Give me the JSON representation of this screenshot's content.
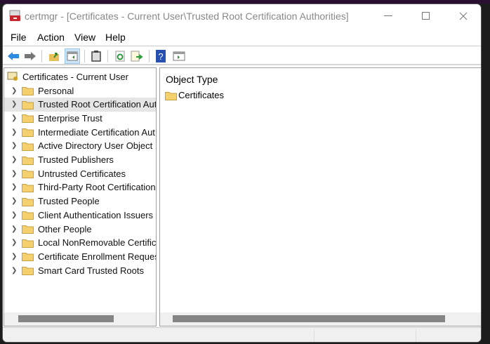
{
  "window": {
    "title": "certmgr - [Certificates - Current User\\Trusted Root Certification Authorities]"
  },
  "menu": [
    "File",
    "Action",
    "View",
    "Help"
  ],
  "toolbar": [
    "back-icon",
    "forward-icon",
    "up-folder-icon",
    "show-hide-tree-icon",
    "clipboard-icon",
    "refresh-icon",
    "export-list-icon",
    "help-icon",
    "show-action-pane-icon"
  ],
  "tree": {
    "root": "Certificates - Current User",
    "items": [
      "Personal",
      "Trusted Root Certification Aut",
      "Enterprise Trust",
      "Intermediate Certification Aut",
      "Active Directory User Object",
      "Trusted Publishers",
      "Untrusted Certificates",
      "Third-Party Root Certification",
      "Trusted People",
      "Client Authentication Issuers",
      "Other People",
      "Local NonRemovable Certifica",
      "Certificate Enrollment Reques",
      "Smart Card Trusted Roots"
    ],
    "selected_index": 1
  },
  "list": {
    "column": "Object Type",
    "items": [
      "Certificates"
    ]
  }
}
